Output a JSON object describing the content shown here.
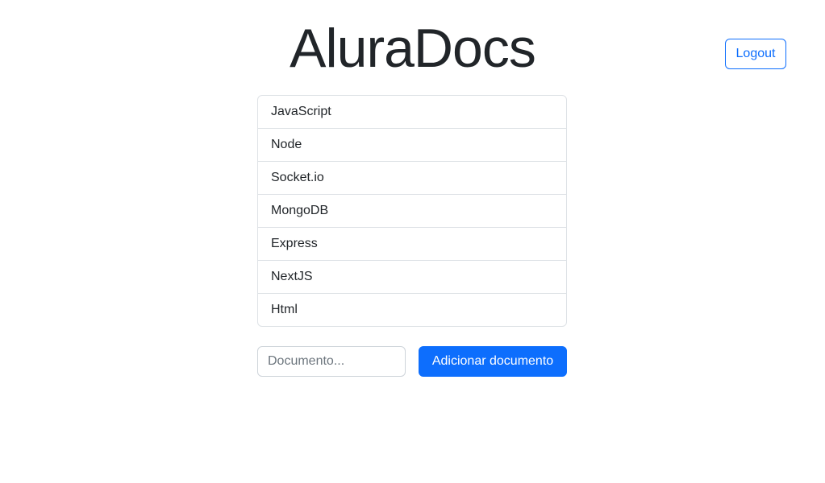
{
  "header": {
    "title": "AluraDocs",
    "logout_label": "Logout"
  },
  "documents": [
    {
      "label": "JavaScript"
    },
    {
      "label": "Node"
    },
    {
      "label": "Socket.io"
    },
    {
      "label": "MongoDB"
    },
    {
      "label": "Express"
    },
    {
      "label": "NextJS"
    },
    {
      "label": "Html"
    }
  ],
  "form": {
    "input_value": "",
    "input_placeholder": "Documento...",
    "submit_label": "Adicionar documento"
  },
  "colors": {
    "primary": "#0d6efd",
    "text": "#212529",
    "border": "#dee2e6"
  }
}
